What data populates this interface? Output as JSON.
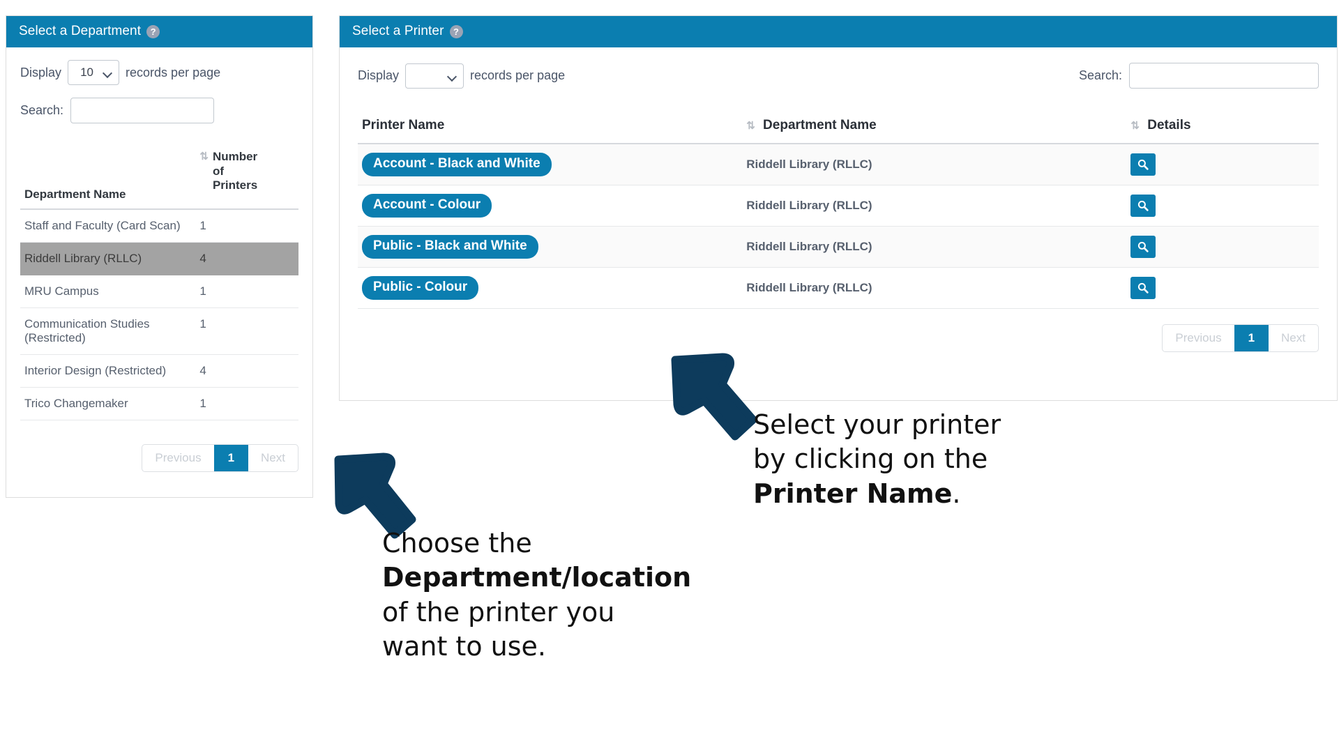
{
  "department_panel": {
    "title": "Select a Department",
    "help_icon": "help-question-icon",
    "length_label_before": "Display",
    "length_label_after": "records per page",
    "length_value": "10",
    "search_label": "Search:",
    "search_value": "",
    "search_placeholder": "",
    "columns": [
      "Department Name",
      "Number of Printers"
    ],
    "rows": [
      {
        "name": "Staff and Faculty (Card Scan)",
        "printers": "1",
        "selected": false
      },
      {
        "name": "Riddell Library (RLLC)",
        "printers": "4",
        "selected": true
      },
      {
        "name": "MRU Campus",
        "printers": "1",
        "selected": false
      },
      {
        "name": "Communication Studies (Restricted)",
        "printers": "1",
        "selected": false
      },
      {
        "name": "Interior Design (Restricted)",
        "printers": "4",
        "selected": false
      },
      {
        "name": "Trico Changemaker",
        "printers": "1",
        "selected": false
      }
    ],
    "pagination": {
      "previous": "Previous",
      "page": "1",
      "next": "Next"
    }
  },
  "printer_panel": {
    "title": "Select a Printer",
    "help_icon": "help-question-icon",
    "length_label_before": "Display",
    "length_label_after": "records per page",
    "length_value": "",
    "search_label": "Search:",
    "search_value": "",
    "search_placeholder": "",
    "columns": [
      "Printer Name",
      "Department Name",
      "Details"
    ],
    "rows": [
      {
        "printer": "Account - Black and White",
        "department": "Riddell Library (RLLC)",
        "details_icon": "magnifier-icon"
      },
      {
        "printer": "Account - Colour",
        "department": "Riddell Library (RLLC)",
        "details_icon": "magnifier-icon"
      },
      {
        "printer": "Public - Black and White",
        "department": "Riddell Library (RLLC)",
        "details_icon": "magnifier-icon"
      },
      {
        "printer": "Public - Colour",
        "department": "Riddell Library (RLLC)",
        "details_icon": "magnifier-icon"
      }
    ],
    "pagination": {
      "previous": "Previous",
      "page": "1",
      "next": "Next"
    }
  },
  "annotations": {
    "department": {
      "line1": "Choose the",
      "bold": "Department/location",
      "line3": "of the printer you",
      "line4": "want to use."
    },
    "printer": {
      "line1": "Select your printer",
      "line2": "by clicking on the",
      "bold": "Printer Name",
      "period": "."
    }
  },
  "colors": {
    "header_blue": "#0b7eb0",
    "arrow_navy": "#0d3b5c",
    "selected_row_grey": "#a3a3a3"
  }
}
